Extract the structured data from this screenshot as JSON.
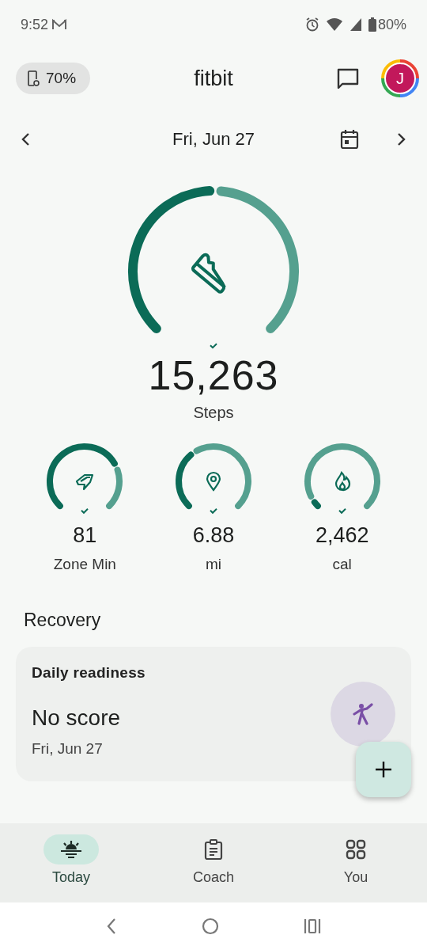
{
  "status_bar": {
    "time": "9:52",
    "battery": "80%"
  },
  "header": {
    "device_battery": "70%",
    "title": "fitbit",
    "avatar_initial": "J"
  },
  "date_nav": {
    "date": "Fri, Jun 27"
  },
  "steps": {
    "value": "15,263",
    "label": "Steps"
  },
  "stats": [
    {
      "kind": "zone",
      "value": "81",
      "label": "Zone Min"
    },
    {
      "kind": "distance",
      "value": "6.88",
      "label": "mi"
    },
    {
      "kind": "calories",
      "value": "2,462",
      "label": "cal"
    }
  ],
  "recovery": {
    "heading": "Recovery",
    "title": "Daily readiness",
    "score": "No score",
    "date": "Fri, Jun 27"
  },
  "nav": [
    {
      "kind": "today",
      "label": "Today",
      "selected": true
    },
    {
      "kind": "coach",
      "label": "Coach",
      "selected": false
    },
    {
      "kind": "you",
      "label": "You",
      "selected": false
    }
  ]
}
